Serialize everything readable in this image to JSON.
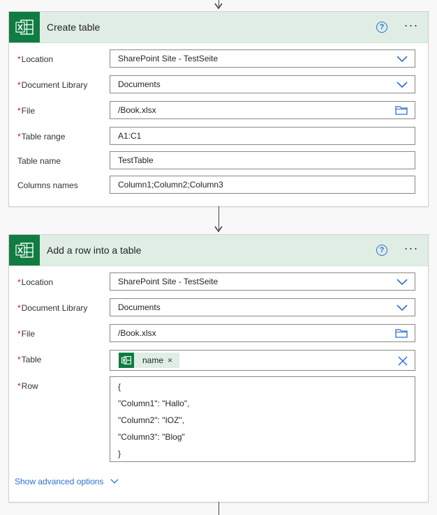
{
  "cards": [
    {
      "title": "Create table",
      "help_symbol": "?",
      "more_symbol": "···",
      "fields": [
        {
          "label": "Location",
          "required": true,
          "value": "SharePoint Site - TestSeite",
          "icon": "chevron-down-icon"
        },
        {
          "label": "Document Library",
          "required": true,
          "value": "Documents",
          "icon": "chevron-down-icon"
        },
        {
          "label": "File",
          "required": true,
          "value": "/Book.xlsx",
          "icon": "folder-icon"
        },
        {
          "label": "Table range",
          "required": true,
          "value": "A1:C1"
        },
        {
          "label": "Table name",
          "required": false,
          "value": "TestTable"
        },
        {
          "label": "Columns names",
          "required": false,
          "value": "Column1;Column2;Column3"
        }
      ]
    },
    {
      "title": "Add a row into a table",
      "help_symbol": "?",
      "more_symbol": "···",
      "fields": [
        {
          "label": "Location",
          "required": true,
          "value": "SharePoint Site - TestSeite",
          "icon": "chevron-down-icon"
        },
        {
          "label": "Document Library",
          "required": true,
          "value": "Documents",
          "icon": "chevron-down-icon"
        },
        {
          "label": "File",
          "required": true,
          "value": "/Book.xlsx",
          "icon": "folder-icon"
        },
        {
          "label": "Table",
          "required": true,
          "token": "name",
          "token_remove": "×",
          "icon": "clear-icon"
        },
        {
          "label": "Row",
          "required": true,
          "lines": [
            "{",
            "\"Column1\": \"Hallo\",",
            "\"Column2\": \"IOZ\",",
            "\"Column3\": \"Blog\"",
            "}"
          ]
        }
      ],
      "advanced_options": "Show advanced options"
    }
  ],
  "required_marker": "*",
  "colors": {
    "excel_green": "#107c41",
    "header_bg": "#dfede5",
    "link_blue": "#2b6fd6",
    "required_red": "#a4262c"
  }
}
